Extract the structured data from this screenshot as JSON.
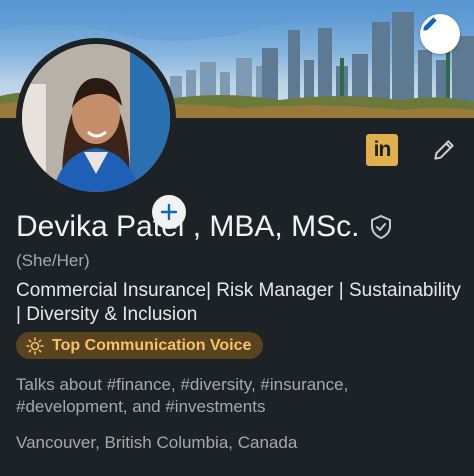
{
  "profile": {
    "name": "Devika Patel , MBA, MSc.",
    "pronouns": "(She/Her)",
    "headline": "Commercial Insurance| Risk Manager | Sustainability | Diversity & Inclusion",
    "badge": "Top Communication Voice",
    "talks_about": "Talks about #finance, #diversity, #insurance, #development, and #investments",
    "location": "Vancouver, British Columbia, Canada"
  },
  "icons": {
    "cover_edit": "pencil-icon",
    "add_photo": "plus-icon",
    "linkedin": "linkedin-icon",
    "edit_profile": "pencil-icon",
    "verified": "shield-check-icon",
    "badge": "sun-icon"
  },
  "linkedin_label": "in",
  "colors": {
    "background": "#1d2226",
    "badge_bg": "#5a4420",
    "badge_text": "#f5c26b",
    "linkedin_gold": "#e0b04c"
  }
}
